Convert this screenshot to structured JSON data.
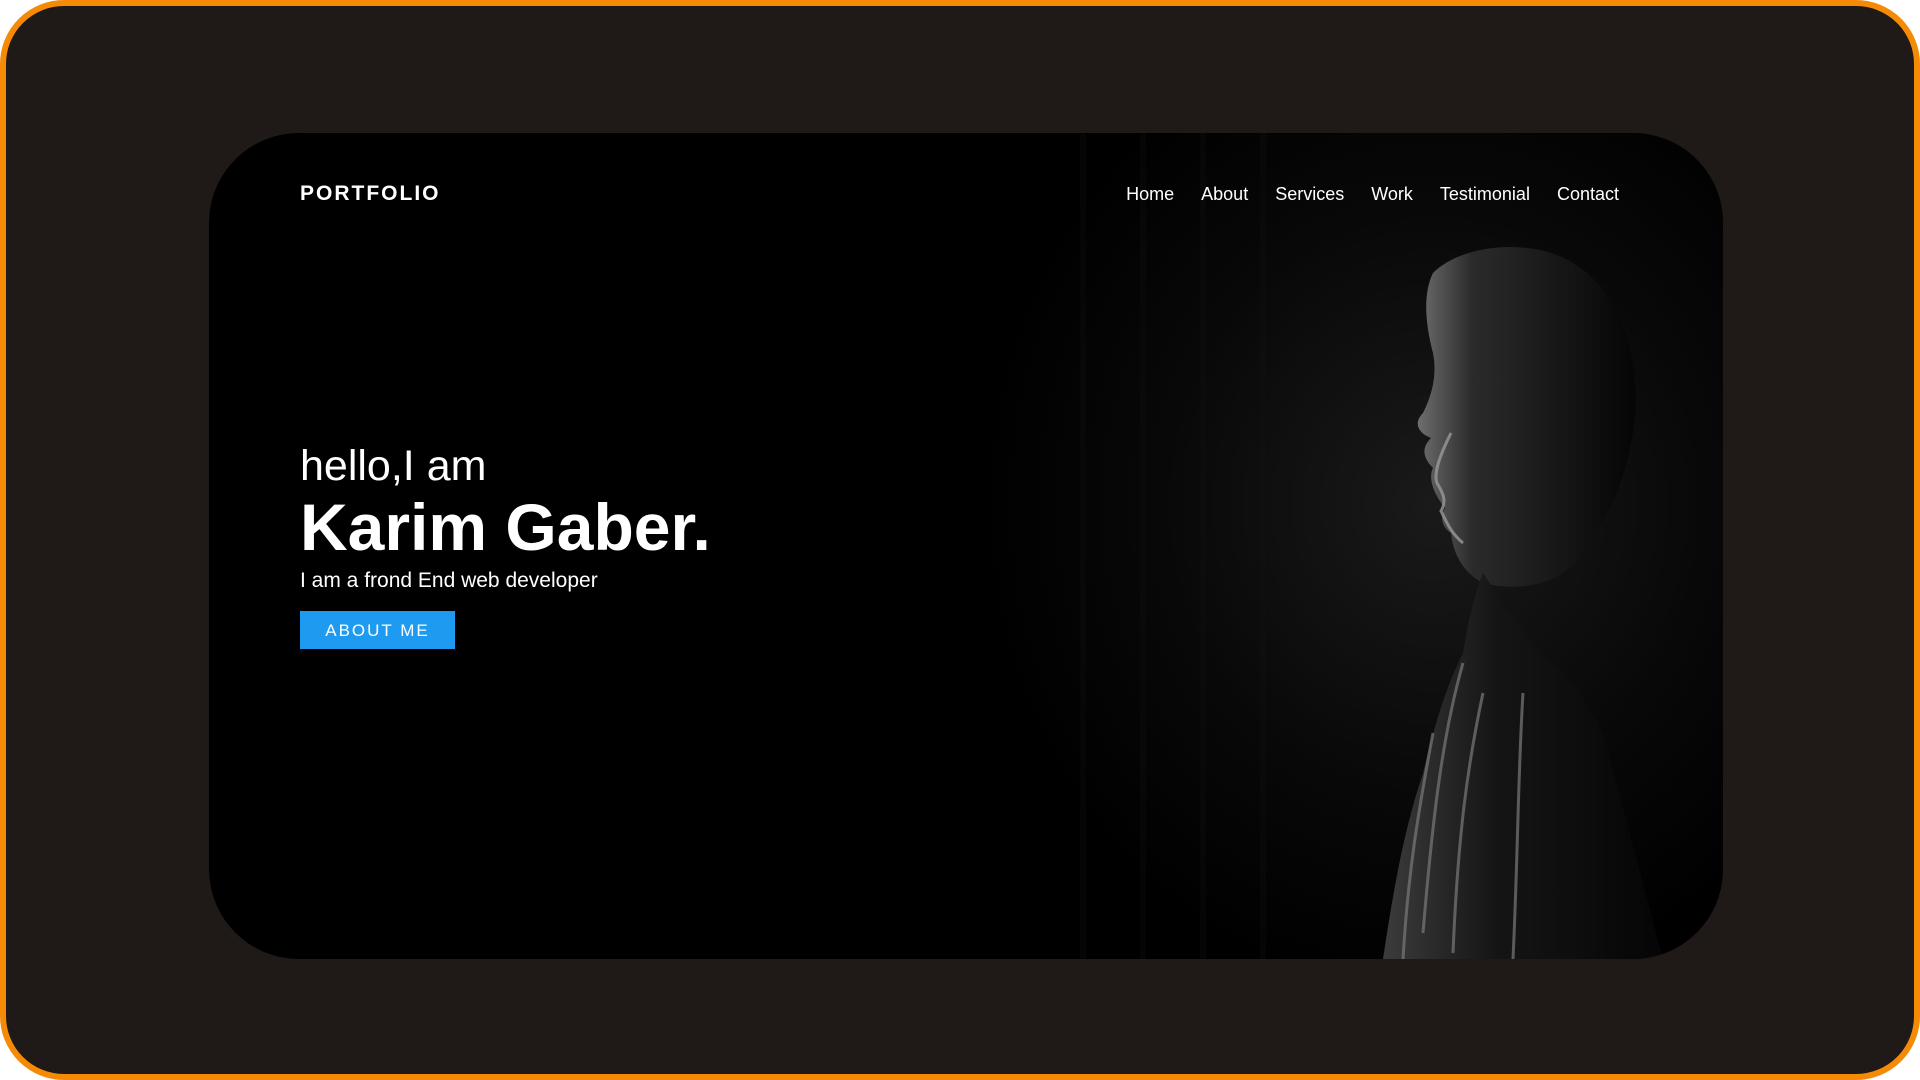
{
  "header": {
    "logo": "PORTFOLIO",
    "nav": [
      {
        "label": "Home"
      },
      {
        "label": "About"
      },
      {
        "label": "Services"
      },
      {
        "label": "Work"
      },
      {
        "label": "Testimonial"
      },
      {
        "label": "Contact"
      }
    ]
  },
  "hero": {
    "greeting": "hello,I am",
    "name": "Karim Gaber.",
    "tagline": "I am a frond End web developer",
    "cta_label": "ABOUT ME",
    "image": "man-profile-portrait"
  },
  "colors": {
    "frame_border": "#f58a07",
    "frame_bg": "#1f1a17",
    "card_bg": "#000000",
    "accent": "#1e9af0",
    "text": "#ffffff"
  }
}
